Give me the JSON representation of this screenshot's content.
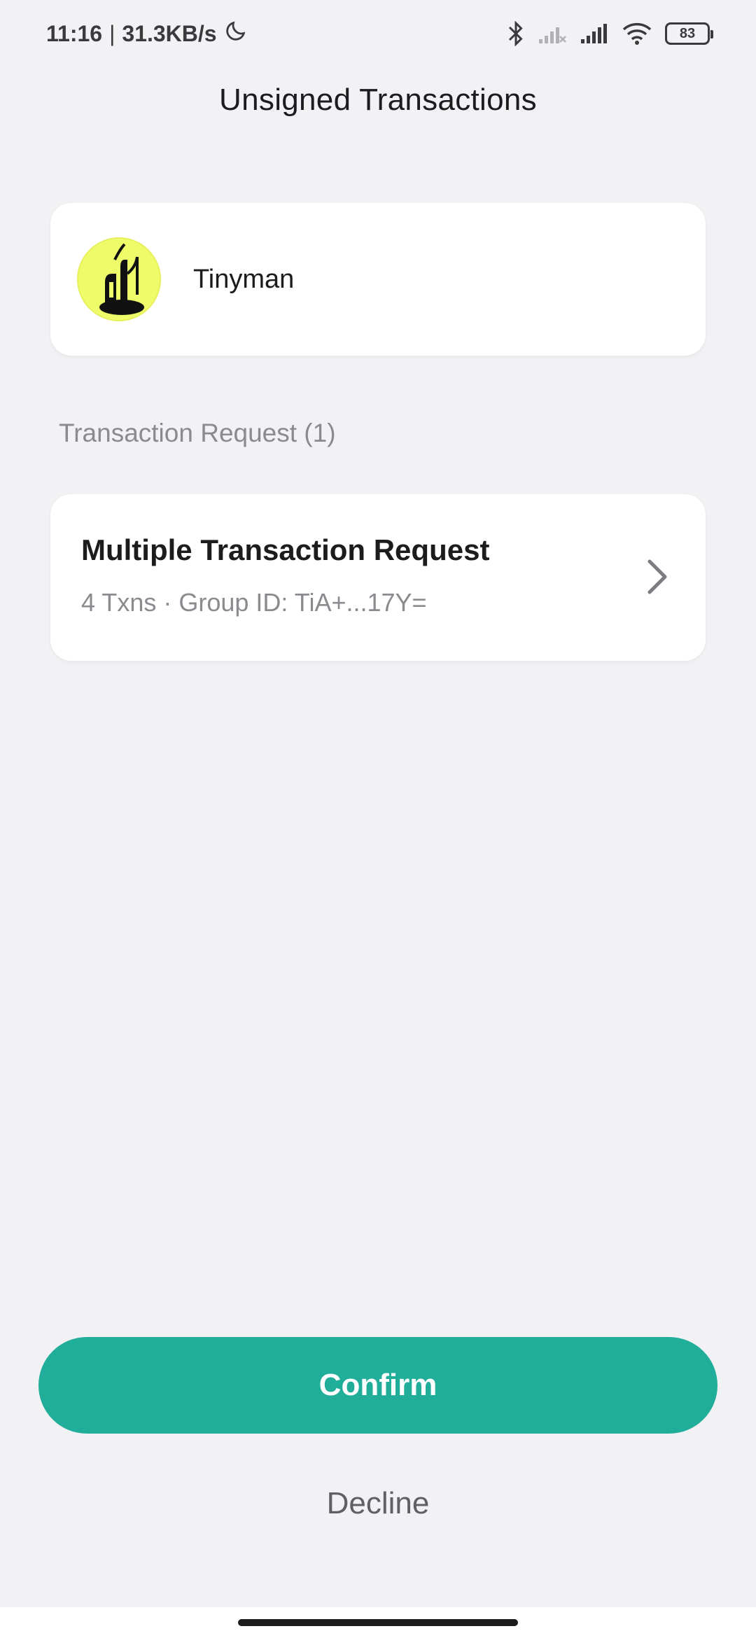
{
  "status_bar": {
    "time": "11:16",
    "separator": "|",
    "network_speed": "31.3KB/s",
    "battery": "83",
    "icons": [
      "moon-icon",
      "bluetooth-icon",
      "signal-x-icon",
      "signal-icon",
      "wifi-icon",
      "battery-icon"
    ]
  },
  "header": {
    "title": "Unsigned Transactions"
  },
  "dapp": {
    "name": "Tinyman",
    "logo": "tinyman-logo"
  },
  "section": {
    "label": "Transaction Request (1)"
  },
  "transaction": {
    "title": "Multiple Transaction Request",
    "subtitle": "4 Txns · Group ID: TiA+...17Y="
  },
  "actions": {
    "confirm_label": "Confirm",
    "decline_label": "Decline"
  },
  "colors": {
    "background": "#f2f2f4",
    "accent": "#20ae9a",
    "logo_bg": "#eefc6a"
  }
}
